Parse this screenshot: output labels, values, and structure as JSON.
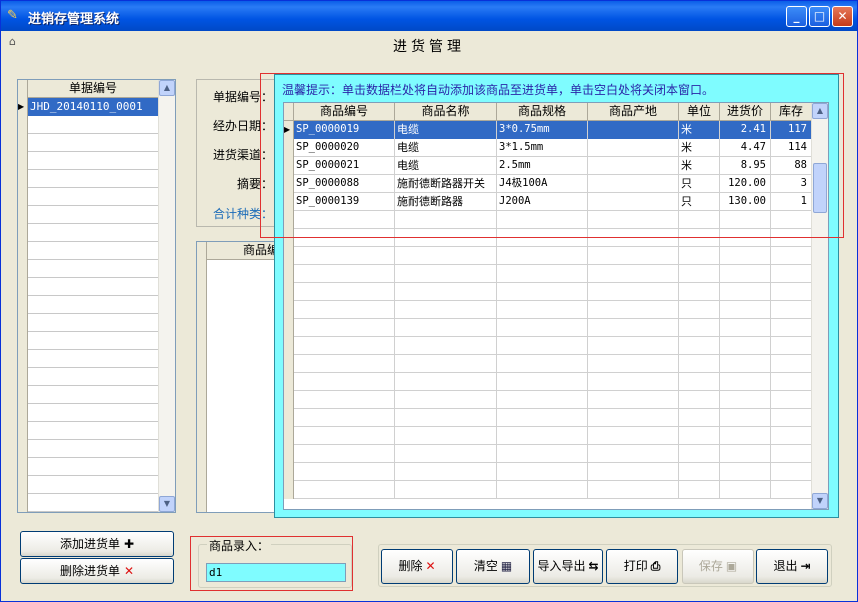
{
  "window": {
    "title": "进销存管理系统",
    "min": "_",
    "max": "□",
    "close": "✕"
  },
  "page_title": "进货管理",
  "left": {
    "header": "单据编号",
    "items": [
      "JHD_20140110_0001"
    ]
  },
  "form": {
    "labels": [
      "单据编号：",
      "经办日期：",
      "进货渠道：",
      "摘要："
    ],
    "sum_label": "合计种类：",
    "grid_header": "商品编"
  },
  "popup": {
    "hint": "温馨提示：单击数据栏处将自动添加该商品至进货单，单击空白处将关闭本窗口。",
    "columns": [
      "商品编号",
      "商品名称",
      "商品规格",
      "商品产地",
      "单位",
      "进货价",
      "库存"
    ],
    "rows": [
      [
        "SP_0000019",
        "电缆",
        "3*0.75mm",
        "",
        "米",
        "2.41",
        "117"
      ],
      [
        "SP_0000020",
        "电缆",
        "3*1.5mm",
        "",
        "米",
        "4.47",
        "114"
      ],
      [
        "SP_0000021",
        "电缆",
        "2.5mm",
        "",
        "米",
        "8.95",
        "88"
      ],
      [
        "SP_0000088",
        "施耐德断路器开关",
        "J4极100A",
        "",
        "只",
        "120.00",
        "3"
      ],
      [
        "SP_0000139",
        "施耐德断路器",
        "J200A",
        "",
        "只",
        "130.00",
        "1"
      ]
    ]
  },
  "bottom": {
    "add_label": "添加进货单",
    "add_icon": "✚",
    "del_label": "删除进货单",
    "del_icon": "✕",
    "entry_legend": "商品录入：",
    "entry_value": "d1",
    "actions": [
      {
        "label": "删除",
        "icon": "✕"
      },
      {
        "label": "清空",
        "icon": "▦"
      },
      {
        "label": "导入导出",
        "icon": "⇆"
      },
      {
        "label": "打印",
        "icon": "⎙"
      },
      {
        "label": "保存",
        "icon": "▣"
      },
      {
        "label": "退出",
        "icon": "⇥"
      }
    ]
  }
}
